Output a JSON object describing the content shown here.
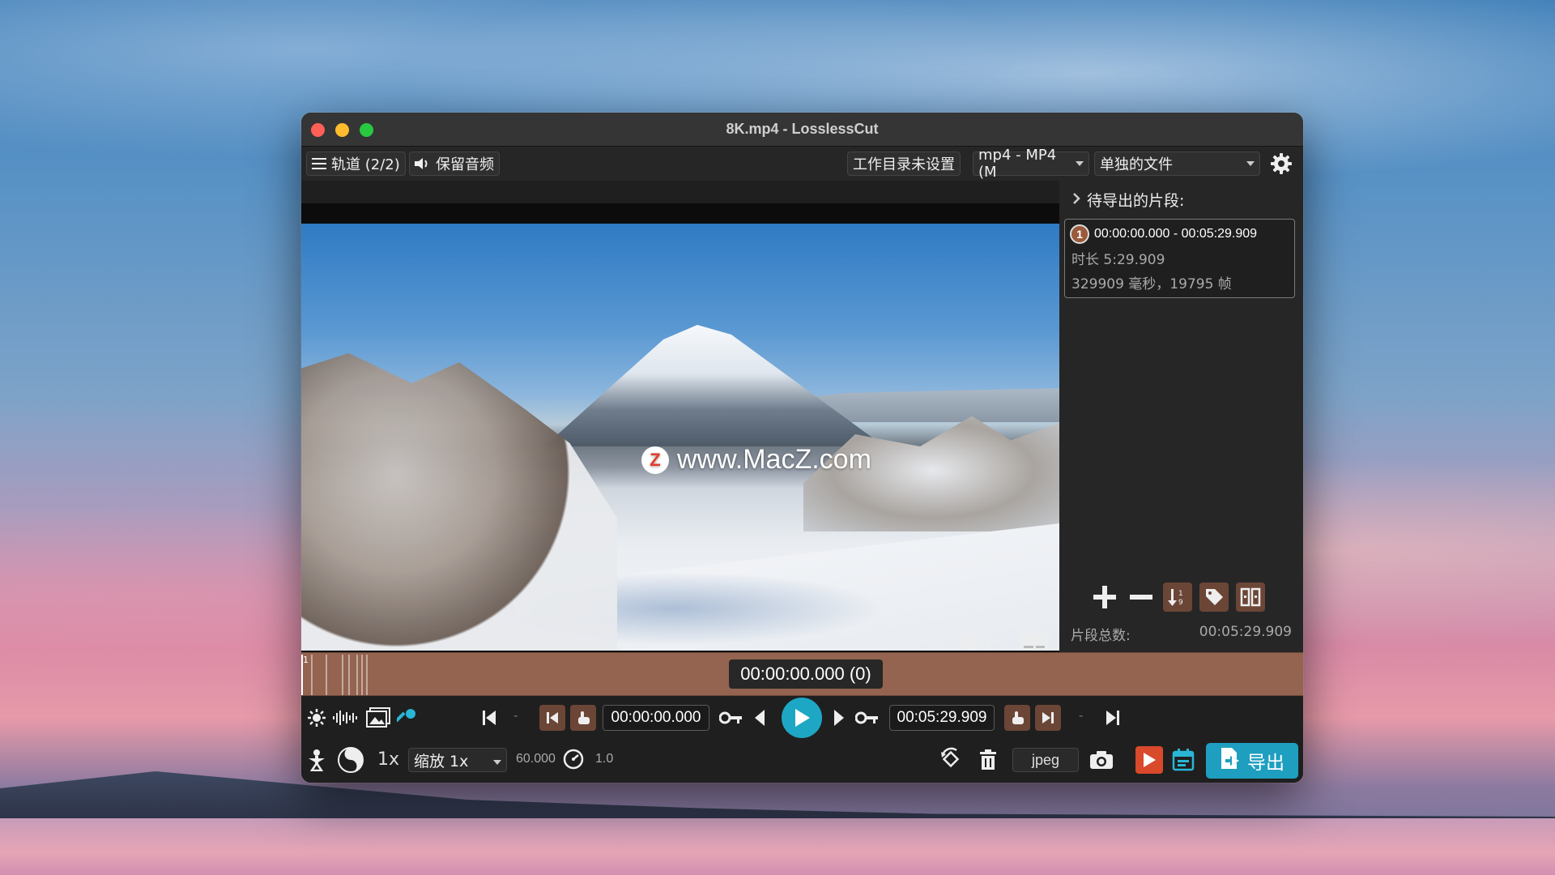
{
  "window": {
    "title": "8K.mp4 - LosslessCut"
  },
  "toolbar": {
    "tracks_label": "轨道 (2/2)",
    "keep_audio_label": "保留音频",
    "workdir_label": "工作目录未设置",
    "format_label": "mp4 - MP4 (M",
    "output_mode_label": "单独的文件"
  },
  "video": {
    "watermark_text": "www.MacZ.com",
    "watermark_logo": "Z"
  },
  "segments_panel": {
    "title": "待导出的片段:",
    "items": [
      {
        "number": "1",
        "range": "00:00:00.000 - 00:05:29.909",
        "duration": "时长 5:29.909",
        "detail": "329909 毫秒，19795 帧"
      }
    ],
    "total_label": "片段总数:",
    "total_value": "00:05:29.909"
  },
  "timeline": {
    "current_time": "00:00:00.000 (0)",
    "marker": "1"
  },
  "controls": {
    "start_time": "00:00:00.000",
    "end_time": "00:05:29.909",
    "dash": "-",
    "speed_label": "1x",
    "zoom_label": "缩放 1x",
    "fps": "60.000",
    "playback_rate": "1.0",
    "capture_format": "jpeg",
    "export_label": "导出"
  },
  "colors": {
    "accent": "#1ea7c4",
    "segment_brown": "#946450",
    "button_brown": "#6b4636",
    "export_red": "#d9492b"
  }
}
